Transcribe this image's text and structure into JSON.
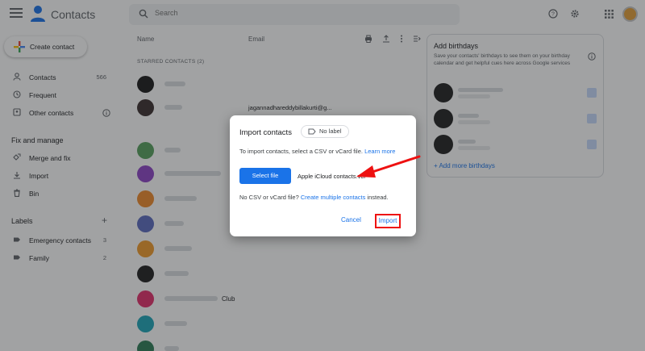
{
  "app": {
    "title": "Contacts"
  },
  "search": {
    "placeholder": "Search"
  },
  "sidebar": {
    "create_label": "Create contact",
    "items": [
      {
        "label": "Contacts",
        "count": "566",
        "icon": "person-icon"
      },
      {
        "label": "Frequent",
        "count": "",
        "icon": "history-icon"
      },
      {
        "label": "Other contacts",
        "count": "",
        "icon": "other-contacts-icon"
      }
    ],
    "fix_heading": "Fix and manage",
    "fix_items": [
      {
        "label": "Merge and fix",
        "icon": "merge-icon"
      },
      {
        "label": "Import",
        "icon": "import-icon"
      },
      {
        "label": "Bin",
        "icon": "bin-icon"
      }
    ],
    "labels_heading": "Labels",
    "labels": [
      {
        "label": "Emergency contacts",
        "count": "3"
      },
      {
        "label": "Family",
        "count": "2"
      }
    ]
  },
  "list": {
    "col_name": "Name",
    "col_email": "Email",
    "starred_heading": "STARRED CONTACTS (2)",
    "visible_email": "jagannadhareddybillakurti@g...",
    "visible_suffix": "Club"
  },
  "birthdays": {
    "title": "Add birthdays",
    "text": "Save your contacts' birthdays to see them on your birthday calendar and get helpful cues here across Google services",
    "add_more": "Add more birthdays"
  },
  "dialog": {
    "title": "Import contacts",
    "chip": "No label",
    "desc_prefix": "To import contacts, select a CSV or vCard file.",
    "learn_more": "Learn more",
    "select_file": "Select file",
    "file_name": "Apple iCloud contacts.vcf",
    "alt_prefix": "No CSV or vCard file?",
    "alt_link": "Create multiple contacts",
    "alt_suffix": "instead.",
    "cancel": "Cancel",
    "import": "Import"
  },
  "colors": {
    "accent": "#1a73e8",
    "highlight": "#e11111",
    "scrim": "#202124"
  }
}
